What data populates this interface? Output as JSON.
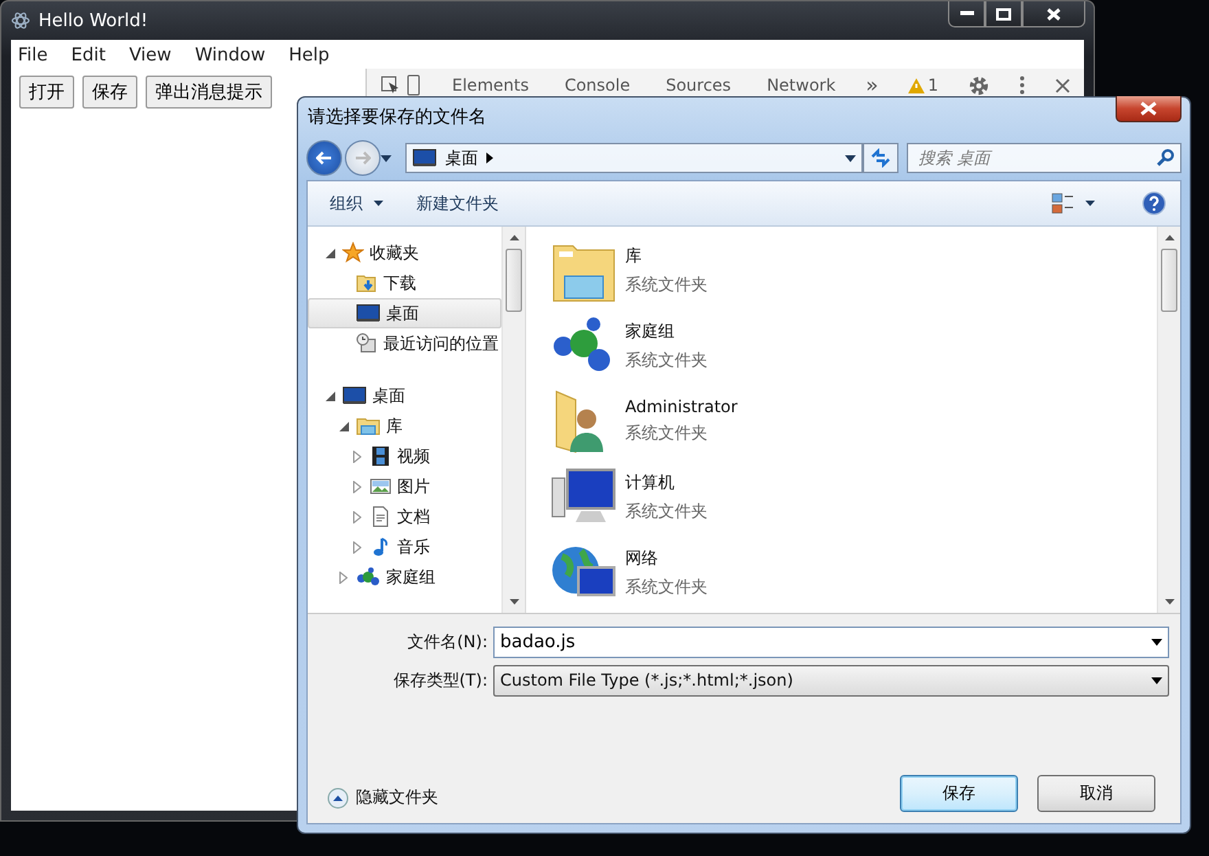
{
  "main_window": {
    "title": "Hello World!",
    "menu": [
      "File",
      "Edit",
      "View",
      "Window",
      "Help"
    ],
    "buttons": [
      "打开",
      "保存",
      "弹出消息提示"
    ],
    "devtools": {
      "tabs": [
        "Elements",
        "Console",
        "Sources",
        "Network"
      ],
      "overflow": "»",
      "warning_count": "1"
    }
  },
  "dialog": {
    "title": "请选择要保存的文件名",
    "breadcrumb": "桌面",
    "search": {
      "placeholder": "搜索 桌面"
    },
    "toolbar": {
      "organize": "组织",
      "new_folder": "新建文件夹"
    },
    "nav_tree": [
      {
        "label": "收藏夹",
        "kind": "star",
        "expanded": true,
        "selected": false,
        "children": [
          {
            "label": "下载",
            "kind": "download",
            "selected": false
          },
          {
            "label": "桌面",
            "kind": "desktop",
            "selected": true
          },
          {
            "label": "最近访问的位置",
            "kind": "recent",
            "selected": false
          }
        ]
      },
      {
        "label": "桌面",
        "kind": "desktop",
        "expanded": true,
        "selected": false,
        "children": [
          {
            "label": "库",
            "kind": "library",
            "expanded": true,
            "selected": false,
            "children": [
              {
                "label": "视频",
                "kind": "video",
                "expanded": false,
                "selected": false
              },
              {
                "label": "图片",
                "kind": "picture",
                "expanded": false,
                "selected": false
              },
              {
                "label": "文档",
                "kind": "document",
                "expanded": false,
                "selected": false
              },
              {
                "label": "音乐",
                "kind": "music",
                "expanded": false,
                "selected": false
              }
            ]
          },
          {
            "label": "家庭组",
            "kind": "homegroup",
            "expanded": false,
            "selected": false
          }
        ]
      }
    ],
    "files": [
      {
        "name": "库",
        "type": "系统文件夹",
        "kind": "library"
      },
      {
        "name": "家庭组",
        "type": "系统文件夹",
        "kind": "homegroup"
      },
      {
        "name": "Administrator",
        "type": "系统文件夹",
        "kind": "user"
      },
      {
        "name": "计算机",
        "type": "系统文件夹",
        "kind": "computer"
      },
      {
        "name": "网络",
        "type": "系统文件夹",
        "kind": "network"
      }
    ],
    "filename": {
      "label": "文件名(N):",
      "value": "badao.js"
    },
    "filetype": {
      "label": "保存类型(T):",
      "value": "Custom File Type (*.js;*.html;*.json)"
    },
    "hide_folders": "隐藏文件夹",
    "buttons": [
      {
        "label": "保存",
        "default": true
      },
      {
        "label": "取消",
        "default": false
      }
    ]
  }
}
